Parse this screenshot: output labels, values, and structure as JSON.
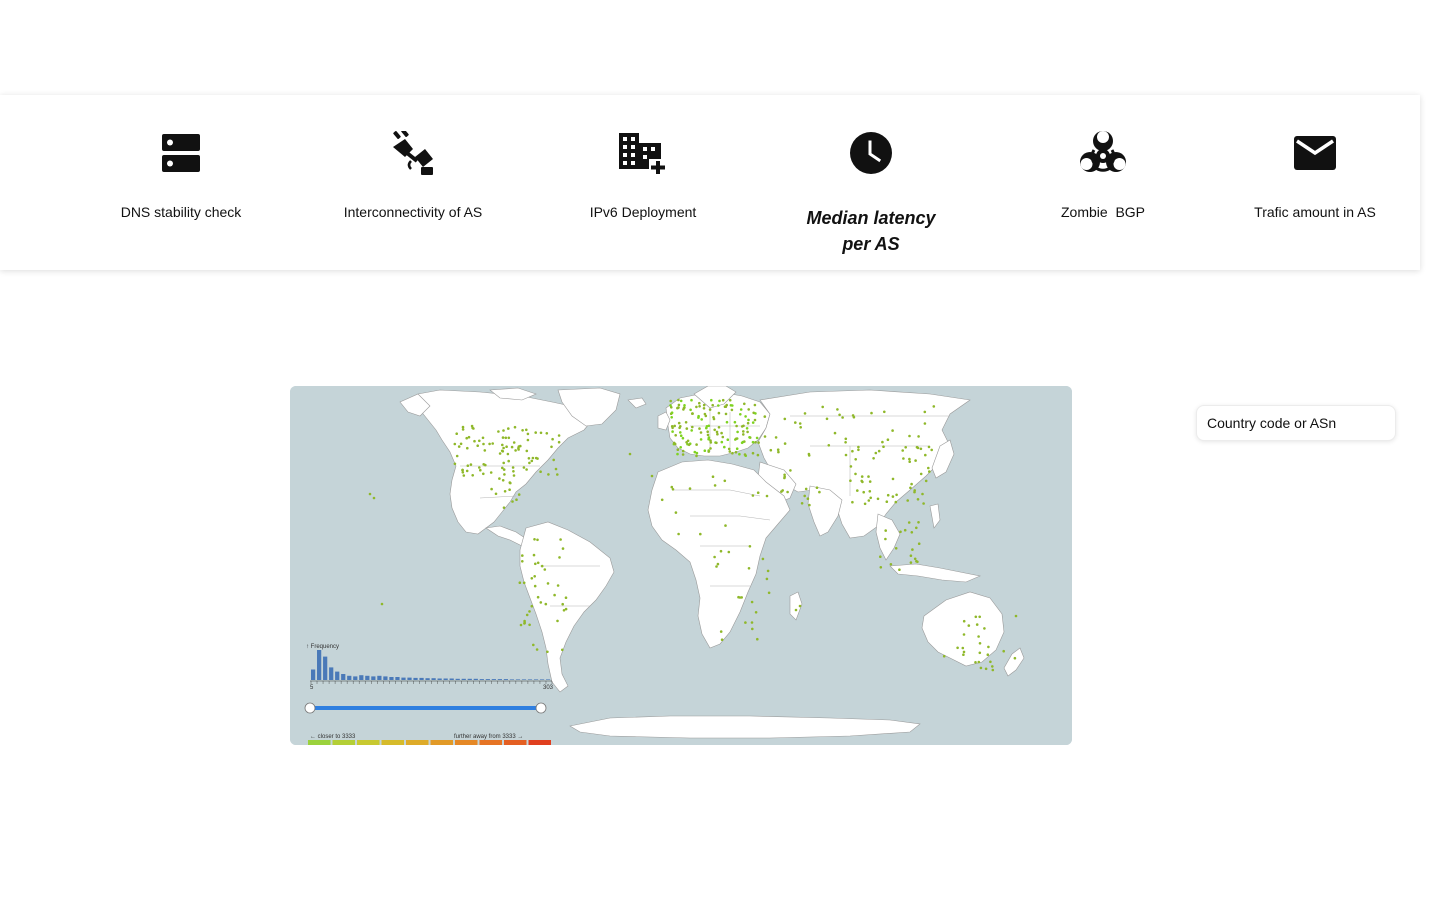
{
  "toolbar": {
    "items": [
      {
        "label": "DNS stability check",
        "icon": "dns-server-icon",
        "active": false
      },
      {
        "label": "Interconnectivity of AS",
        "icon": "cable-connect-icon",
        "active": false
      },
      {
        "label": "IPv6 Deployment",
        "icon": "building-add-icon",
        "active": false
      },
      {
        "label": "Median latency per AS",
        "icon": "clock-icon",
        "active": true
      },
      {
        "label": "Zombie  BGP",
        "icon": "biohazard-icon",
        "active": false
      },
      {
        "label": "Trafic amount in AS",
        "icon": "mail-icon",
        "active": false
      }
    ]
  },
  "search": {
    "placeholder": "Country code or ASn"
  },
  "legend": {
    "histogram_title": "↑ Frequency",
    "closer_label": "← closer to 3333",
    "further_label": "further away from 3333 →",
    "tick_first": "5",
    "tick_last": "303",
    "histogram_values": [
      0.35,
      1.0,
      0.78,
      0.42,
      0.28,
      0.2,
      0.14,
      0.12,
      0.16,
      0.14,
      0.12,
      0.14,
      0.12,
      0.1,
      0.1,
      0.08,
      0.08,
      0.07,
      0.07,
      0.06,
      0.06,
      0.05,
      0.05,
      0.05,
      0.04,
      0.04,
      0.04,
      0.04,
      0.03,
      0.03,
      0.03,
      0.03,
      0.03,
      0.02,
      0.02,
      0.02,
      0.02,
      0.02,
      0.02,
      0.02
    ],
    "slider_range": [
      0,
      1
    ],
    "color_scale": [
      "#9bd23c",
      "#b4cf36",
      "#c8c930",
      "#d6bb2b",
      "#deab29",
      "#e29a27",
      "#e58826",
      "#e67424",
      "#e45f22",
      "#e03f1f"
    ]
  },
  "colors": {
    "ocean": "#c5d4d8",
    "land": "#ffffff",
    "borders": "#9a9a9a",
    "dots": "#8fb82a",
    "dots_dense": "#7ed321",
    "slider": "#2f7fe0",
    "bars": "#4a79b8"
  }
}
